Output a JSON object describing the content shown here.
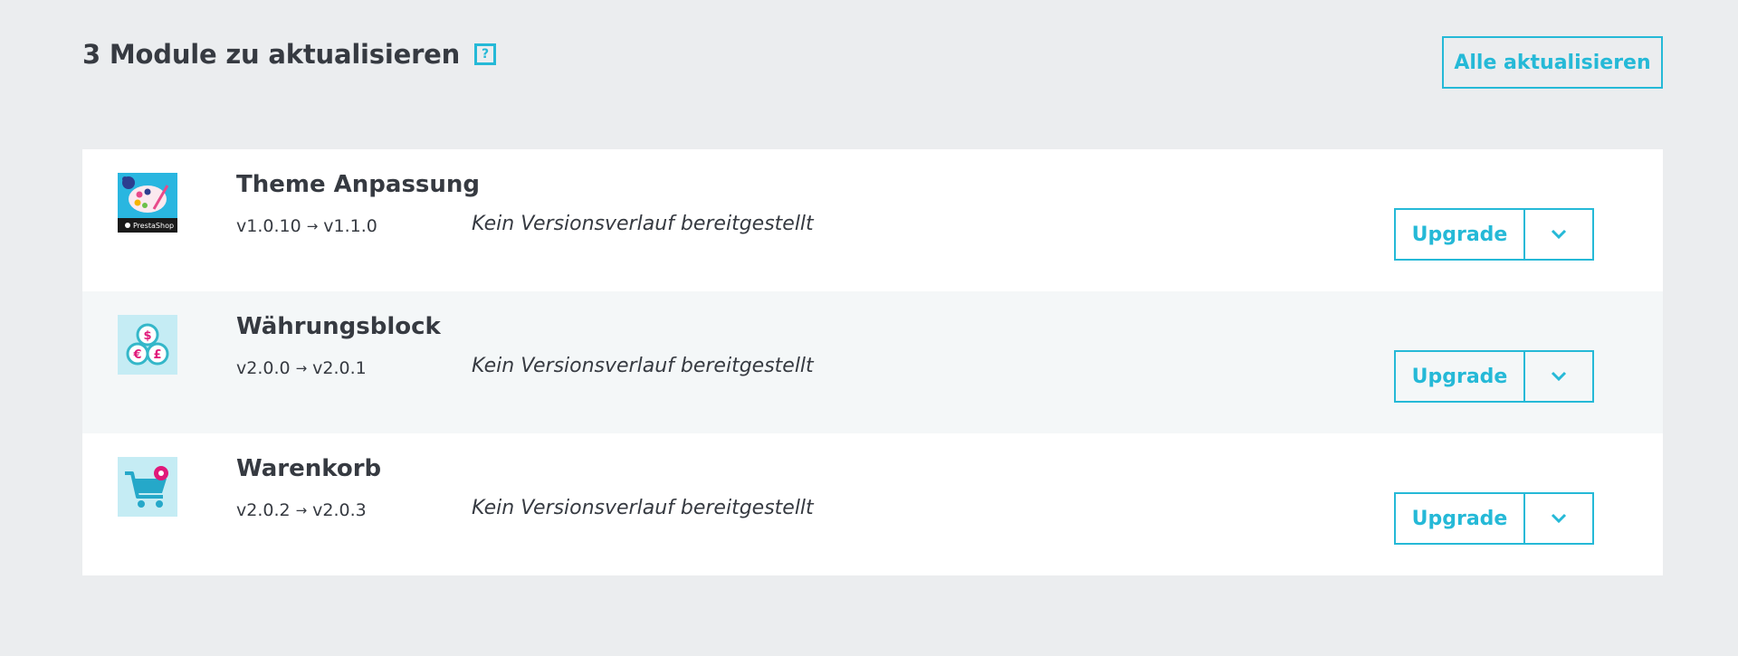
{
  "header": {
    "title": "3 Module zu aktualisieren",
    "help_icon": "?",
    "update_all_label": "Alle aktualisieren"
  },
  "colors": {
    "accent": "#25b9d7",
    "text": "#363a41",
    "page_bg": "#ebedef",
    "row_alt_bg": "#f4f7f8"
  },
  "modules": [
    {
      "name": "Theme Anpassung",
      "version_from": "v1.0.10",
      "version_to": "v1.1.0",
      "changelog": "Kein Versionsverlauf bereitgestellt",
      "upgrade_label": "Upgrade",
      "icon": "theme-palette-icon",
      "logo_text": "PrestaShop"
    },
    {
      "name": "Währungsblock",
      "version_from": "v2.0.0",
      "version_to": "v2.0.1",
      "changelog": "Kein Versionsverlauf bereitgestellt",
      "upgrade_label": "Upgrade",
      "icon": "currency-coins-icon"
    },
    {
      "name": "Warenkorb",
      "version_from": "v2.0.2",
      "version_to": "v2.0.3",
      "changelog": "Kein Versionsverlauf bereitgestellt",
      "upgrade_label": "Upgrade",
      "icon": "shopping-cart-icon"
    }
  ]
}
